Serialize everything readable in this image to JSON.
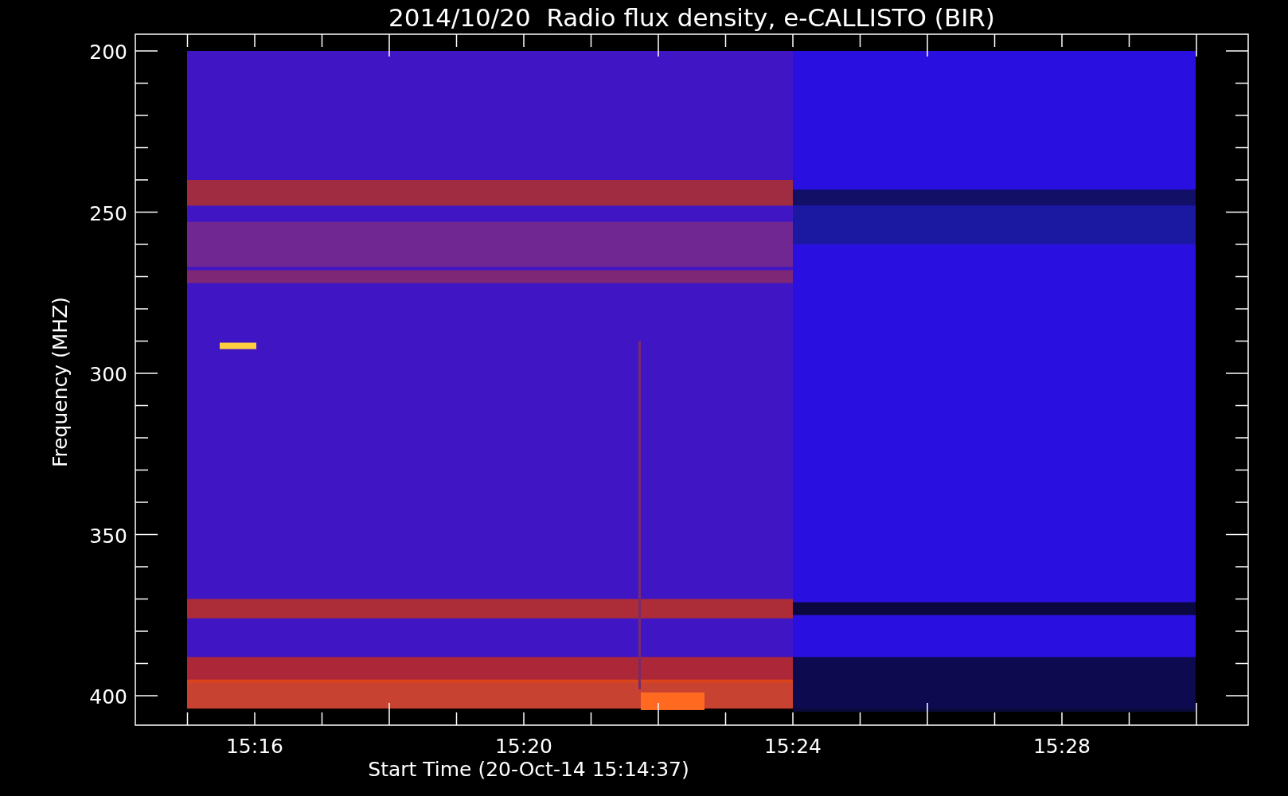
{
  "title": "2014/10/20  Radio flux density, e-CALLISTO (BIR)",
  "y_axis": {
    "label": "Frequency (MHZ)",
    "ticks": [
      "200",
      "250",
      "300",
      "350",
      "400"
    ]
  },
  "x_axis": {
    "label": "Start Time (20-Oct-14 15:14:37)",
    "ticks": [
      "15:16",
      "15:20",
      "15:24",
      "15:28"
    ]
  }
}
